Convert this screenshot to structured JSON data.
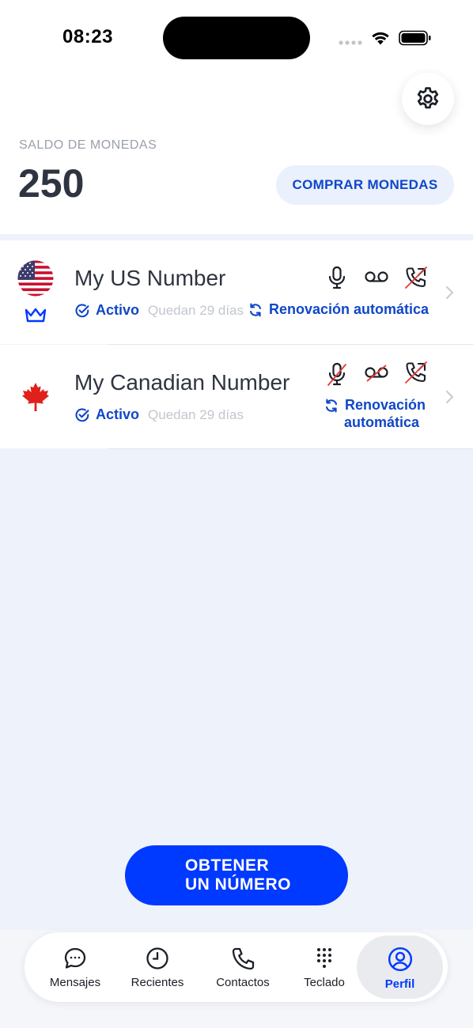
{
  "status_bar": {
    "time": "08:23"
  },
  "balance": {
    "label": "SALDO DE MONEDAS",
    "value": "250",
    "buy_label": "COMPRAR MONEDAS"
  },
  "numbers": [
    {
      "name": "My US Number",
      "country": "US",
      "status": "Activo",
      "remaining": "Quedan 29 días",
      "renewal": "Renovación automática",
      "premium": true,
      "features": {
        "microphone": "enabled",
        "voicemail": "enabled",
        "call_forwarding": "disabled"
      }
    },
    {
      "name": "My Canadian Number",
      "country": "CA",
      "status": "Activo",
      "remaining": "Quedan 29 días",
      "renewal_line1": "Renovación",
      "renewal_line2": "automática",
      "premium": false,
      "features": {
        "microphone": "disabled",
        "voicemail": "disabled",
        "call_forwarding": "disabled"
      }
    }
  ],
  "cta": {
    "line1": "OBTENER",
    "line2": "UN NÚMERO"
  },
  "tabs": [
    {
      "label": "Mensajes",
      "icon": "chat-bubble-icon"
    },
    {
      "label": "Recientes",
      "icon": "clock-icon"
    },
    {
      "label": "Contactos",
      "icon": "phone-icon"
    },
    {
      "label": "Teclado",
      "icon": "keypad-icon"
    },
    {
      "label": "Perfil",
      "icon": "profile-icon",
      "active": true
    }
  ],
  "colors": {
    "accent": "#0039FF",
    "link": "#0F47C8",
    "background": "#EEF2FB",
    "text": "#2E3440",
    "muted": "#9AA0AA",
    "disabled_slash": "#E53935"
  }
}
